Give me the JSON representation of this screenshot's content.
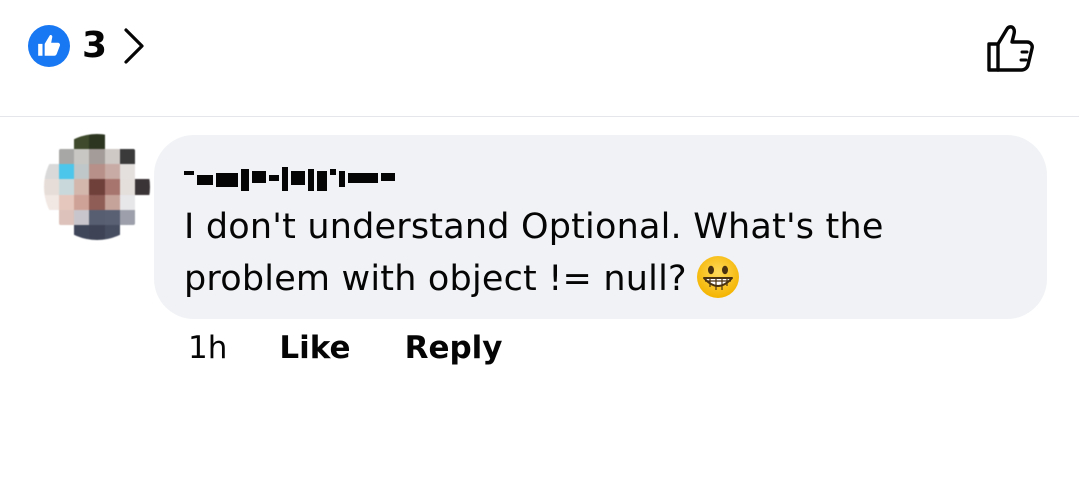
{
  "reactions": {
    "count": "3",
    "icon": "like-badge-icon",
    "accent_color": "#1877f2"
  },
  "toolbar": {
    "like_icon": "thumbs-up-outline-icon"
  },
  "comment": {
    "author_redacted": true,
    "text": "I don't understand Optional. What's the problem with object != null?",
    "emoji": "grinning-face-emoji",
    "timestamp": "1h",
    "like_label": "Like",
    "reply_label": "Reply",
    "bubble_color": "#f0f2f5"
  }
}
